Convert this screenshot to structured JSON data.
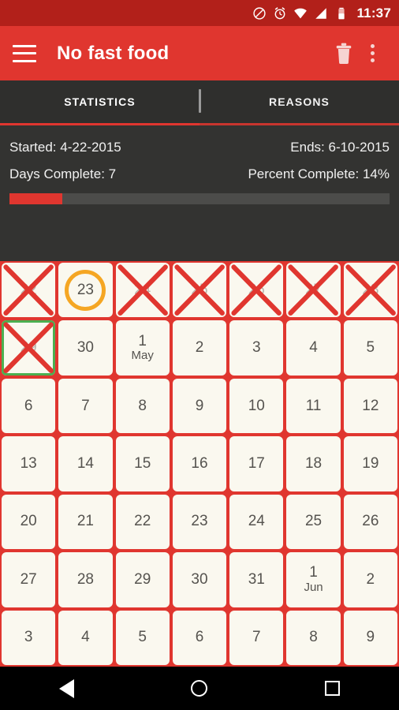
{
  "statusbar": {
    "time": "11:37",
    "icons": [
      "do-not-disturb-icon",
      "alarm-icon",
      "wifi-icon",
      "signal-icon",
      "battery-icon"
    ]
  },
  "appbar": {
    "menu_icon": "hamburger-menu-icon",
    "title": "No fast food",
    "delete_icon": "trash-icon",
    "overflow_icon": "overflow-menu-icon",
    "background": "#e0362f"
  },
  "tabs": {
    "items": [
      {
        "label": "STATISTICS",
        "active": true
      },
      {
        "label": "REASONS",
        "active": false
      }
    ],
    "indicator_color": "#e0362f"
  },
  "stats": {
    "started_label": "Started: 4-22-2015",
    "ends_label": "Ends: 6-10-2015",
    "days_complete_label": "Days Complete: 7",
    "percent_complete_label": "Percent Complete: 14%",
    "progress_percent": 14,
    "progress_color": "#e0362f",
    "track_color": "#4c4c4a",
    "background": "#333331"
  },
  "calendar": {
    "grid_color": "#e0362f",
    "cell_color": "#faf8ef",
    "today_ring_color": "#f5a623",
    "selected_border_color": "#4caf50",
    "x_mark_color": "#e0362f",
    "columns": 7,
    "cells": [
      {
        "num": "22",
        "month": "",
        "marked": true,
        "ring": false,
        "selected": false
      },
      {
        "num": "23",
        "month": "",
        "marked": false,
        "ring": true,
        "selected": false
      },
      {
        "num": "24",
        "month": "",
        "marked": true,
        "ring": false,
        "selected": false
      },
      {
        "num": "25",
        "month": "",
        "marked": true,
        "ring": false,
        "selected": false
      },
      {
        "num": "26",
        "month": "",
        "marked": true,
        "ring": false,
        "selected": false
      },
      {
        "num": "27",
        "month": "",
        "marked": true,
        "ring": false,
        "selected": false
      },
      {
        "num": "28",
        "month": "",
        "marked": true,
        "ring": false,
        "selected": false
      },
      {
        "num": "29",
        "month": "",
        "marked": true,
        "ring": false,
        "selected": true
      },
      {
        "num": "30",
        "month": "",
        "marked": false,
        "ring": false,
        "selected": false
      },
      {
        "num": "1",
        "month": "May",
        "marked": false,
        "ring": false,
        "selected": false
      },
      {
        "num": "2",
        "month": "",
        "marked": false,
        "ring": false,
        "selected": false
      },
      {
        "num": "3",
        "month": "",
        "marked": false,
        "ring": false,
        "selected": false
      },
      {
        "num": "4",
        "month": "",
        "marked": false,
        "ring": false,
        "selected": false
      },
      {
        "num": "5",
        "month": "",
        "marked": false,
        "ring": false,
        "selected": false
      },
      {
        "num": "6",
        "month": "",
        "marked": false,
        "ring": false,
        "selected": false
      },
      {
        "num": "7",
        "month": "",
        "marked": false,
        "ring": false,
        "selected": false
      },
      {
        "num": "8",
        "month": "",
        "marked": false,
        "ring": false,
        "selected": false
      },
      {
        "num": "9",
        "month": "",
        "marked": false,
        "ring": false,
        "selected": false
      },
      {
        "num": "10",
        "month": "",
        "marked": false,
        "ring": false,
        "selected": false
      },
      {
        "num": "11",
        "month": "",
        "marked": false,
        "ring": false,
        "selected": false
      },
      {
        "num": "12",
        "month": "",
        "marked": false,
        "ring": false,
        "selected": false
      },
      {
        "num": "13",
        "month": "",
        "marked": false,
        "ring": false,
        "selected": false
      },
      {
        "num": "14",
        "month": "",
        "marked": false,
        "ring": false,
        "selected": false
      },
      {
        "num": "15",
        "month": "",
        "marked": false,
        "ring": false,
        "selected": false
      },
      {
        "num": "16",
        "month": "",
        "marked": false,
        "ring": false,
        "selected": false
      },
      {
        "num": "17",
        "month": "",
        "marked": false,
        "ring": false,
        "selected": false
      },
      {
        "num": "18",
        "month": "",
        "marked": false,
        "ring": false,
        "selected": false
      },
      {
        "num": "19",
        "month": "",
        "marked": false,
        "ring": false,
        "selected": false
      },
      {
        "num": "20",
        "month": "",
        "marked": false,
        "ring": false,
        "selected": false
      },
      {
        "num": "21",
        "month": "",
        "marked": false,
        "ring": false,
        "selected": false
      },
      {
        "num": "22",
        "month": "",
        "marked": false,
        "ring": false,
        "selected": false
      },
      {
        "num": "23",
        "month": "",
        "marked": false,
        "ring": false,
        "selected": false
      },
      {
        "num": "24",
        "month": "",
        "marked": false,
        "ring": false,
        "selected": false
      },
      {
        "num": "25",
        "month": "",
        "marked": false,
        "ring": false,
        "selected": false
      },
      {
        "num": "26",
        "month": "",
        "marked": false,
        "ring": false,
        "selected": false
      },
      {
        "num": "27",
        "month": "",
        "marked": false,
        "ring": false,
        "selected": false
      },
      {
        "num": "28",
        "month": "",
        "marked": false,
        "ring": false,
        "selected": false
      },
      {
        "num": "29",
        "month": "",
        "marked": false,
        "ring": false,
        "selected": false
      },
      {
        "num": "30",
        "month": "",
        "marked": false,
        "ring": false,
        "selected": false
      },
      {
        "num": "31",
        "month": "",
        "marked": false,
        "ring": false,
        "selected": false
      },
      {
        "num": "1",
        "month": "Jun",
        "marked": false,
        "ring": false,
        "selected": false
      },
      {
        "num": "2",
        "month": "",
        "marked": false,
        "ring": false,
        "selected": false
      },
      {
        "num": "3",
        "month": "",
        "marked": false,
        "ring": false,
        "selected": false
      },
      {
        "num": "4",
        "month": "",
        "marked": false,
        "ring": false,
        "selected": false
      },
      {
        "num": "5",
        "month": "",
        "marked": false,
        "ring": false,
        "selected": false
      },
      {
        "num": "6",
        "month": "",
        "marked": false,
        "ring": false,
        "selected": false
      },
      {
        "num": "7",
        "month": "",
        "marked": false,
        "ring": false,
        "selected": false
      },
      {
        "num": "8",
        "month": "",
        "marked": false,
        "ring": false,
        "selected": false
      },
      {
        "num": "9",
        "month": "",
        "marked": false,
        "ring": false,
        "selected": false
      }
    ]
  },
  "navbar": {
    "back_icon": "back-triangle-icon",
    "home_icon": "home-circle-icon",
    "recents_icon": "recents-square-icon"
  }
}
